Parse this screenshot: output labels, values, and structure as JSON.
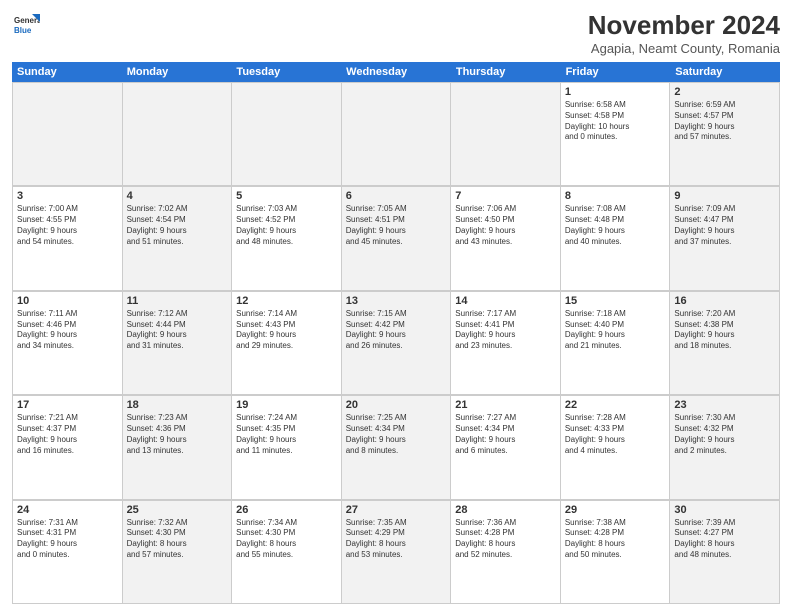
{
  "header": {
    "title": "November 2024",
    "subtitle": "Agapia, Neamt County, Romania",
    "logo_general": "General",
    "logo_blue": "Blue"
  },
  "weekdays": [
    "Sunday",
    "Monday",
    "Tuesday",
    "Wednesday",
    "Thursday",
    "Friday",
    "Saturday"
  ],
  "rows": [
    [
      {
        "day": "",
        "info": "",
        "shaded": true
      },
      {
        "day": "",
        "info": "",
        "shaded": true
      },
      {
        "day": "",
        "info": "",
        "shaded": true
      },
      {
        "day": "",
        "info": "",
        "shaded": true
      },
      {
        "day": "",
        "info": "",
        "shaded": true
      },
      {
        "day": "1",
        "info": "Sunrise: 6:58 AM\nSunset: 4:58 PM\nDaylight: 10 hours\nand 0 minutes.",
        "shaded": false
      },
      {
        "day": "2",
        "info": "Sunrise: 6:59 AM\nSunset: 4:57 PM\nDaylight: 9 hours\nand 57 minutes.",
        "shaded": true
      }
    ],
    [
      {
        "day": "3",
        "info": "Sunrise: 7:00 AM\nSunset: 4:55 PM\nDaylight: 9 hours\nand 54 minutes.",
        "shaded": false
      },
      {
        "day": "4",
        "info": "Sunrise: 7:02 AM\nSunset: 4:54 PM\nDaylight: 9 hours\nand 51 minutes.",
        "shaded": true
      },
      {
        "day": "5",
        "info": "Sunrise: 7:03 AM\nSunset: 4:52 PM\nDaylight: 9 hours\nand 48 minutes.",
        "shaded": false
      },
      {
        "day": "6",
        "info": "Sunrise: 7:05 AM\nSunset: 4:51 PM\nDaylight: 9 hours\nand 45 minutes.",
        "shaded": true
      },
      {
        "day": "7",
        "info": "Sunrise: 7:06 AM\nSunset: 4:50 PM\nDaylight: 9 hours\nand 43 minutes.",
        "shaded": false
      },
      {
        "day": "8",
        "info": "Sunrise: 7:08 AM\nSunset: 4:48 PM\nDaylight: 9 hours\nand 40 minutes.",
        "shaded": false
      },
      {
        "day": "9",
        "info": "Sunrise: 7:09 AM\nSunset: 4:47 PM\nDaylight: 9 hours\nand 37 minutes.",
        "shaded": true
      }
    ],
    [
      {
        "day": "10",
        "info": "Sunrise: 7:11 AM\nSunset: 4:46 PM\nDaylight: 9 hours\nand 34 minutes.",
        "shaded": false
      },
      {
        "day": "11",
        "info": "Sunrise: 7:12 AM\nSunset: 4:44 PM\nDaylight: 9 hours\nand 31 minutes.",
        "shaded": true
      },
      {
        "day": "12",
        "info": "Sunrise: 7:14 AM\nSunset: 4:43 PM\nDaylight: 9 hours\nand 29 minutes.",
        "shaded": false
      },
      {
        "day": "13",
        "info": "Sunrise: 7:15 AM\nSunset: 4:42 PM\nDaylight: 9 hours\nand 26 minutes.",
        "shaded": true
      },
      {
        "day": "14",
        "info": "Sunrise: 7:17 AM\nSunset: 4:41 PM\nDaylight: 9 hours\nand 23 minutes.",
        "shaded": false
      },
      {
        "day": "15",
        "info": "Sunrise: 7:18 AM\nSunset: 4:40 PM\nDaylight: 9 hours\nand 21 minutes.",
        "shaded": false
      },
      {
        "day": "16",
        "info": "Sunrise: 7:20 AM\nSunset: 4:38 PM\nDaylight: 9 hours\nand 18 minutes.",
        "shaded": true
      }
    ],
    [
      {
        "day": "17",
        "info": "Sunrise: 7:21 AM\nSunset: 4:37 PM\nDaylight: 9 hours\nand 16 minutes.",
        "shaded": false
      },
      {
        "day": "18",
        "info": "Sunrise: 7:23 AM\nSunset: 4:36 PM\nDaylight: 9 hours\nand 13 minutes.",
        "shaded": true
      },
      {
        "day": "19",
        "info": "Sunrise: 7:24 AM\nSunset: 4:35 PM\nDaylight: 9 hours\nand 11 minutes.",
        "shaded": false
      },
      {
        "day": "20",
        "info": "Sunrise: 7:25 AM\nSunset: 4:34 PM\nDaylight: 9 hours\nand 8 minutes.",
        "shaded": true
      },
      {
        "day": "21",
        "info": "Sunrise: 7:27 AM\nSunset: 4:34 PM\nDaylight: 9 hours\nand 6 minutes.",
        "shaded": false
      },
      {
        "day": "22",
        "info": "Sunrise: 7:28 AM\nSunset: 4:33 PM\nDaylight: 9 hours\nand 4 minutes.",
        "shaded": false
      },
      {
        "day": "23",
        "info": "Sunrise: 7:30 AM\nSunset: 4:32 PM\nDaylight: 9 hours\nand 2 minutes.",
        "shaded": true
      }
    ],
    [
      {
        "day": "24",
        "info": "Sunrise: 7:31 AM\nSunset: 4:31 PM\nDaylight: 9 hours\nand 0 minutes.",
        "shaded": false
      },
      {
        "day": "25",
        "info": "Sunrise: 7:32 AM\nSunset: 4:30 PM\nDaylight: 8 hours\nand 57 minutes.",
        "shaded": true
      },
      {
        "day": "26",
        "info": "Sunrise: 7:34 AM\nSunset: 4:30 PM\nDaylight: 8 hours\nand 55 minutes.",
        "shaded": false
      },
      {
        "day": "27",
        "info": "Sunrise: 7:35 AM\nSunset: 4:29 PM\nDaylight: 8 hours\nand 53 minutes.",
        "shaded": true
      },
      {
        "day": "28",
        "info": "Sunrise: 7:36 AM\nSunset: 4:28 PM\nDaylight: 8 hours\nand 52 minutes.",
        "shaded": false
      },
      {
        "day": "29",
        "info": "Sunrise: 7:38 AM\nSunset: 4:28 PM\nDaylight: 8 hours\nand 50 minutes.",
        "shaded": false
      },
      {
        "day": "30",
        "info": "Sunrise: 7:39 AM\nSunset: 4:27 PM\nDaylight: 8 hours\nand 48 minutes.",
        "shaded": true
      }
    ]
  ]
}
